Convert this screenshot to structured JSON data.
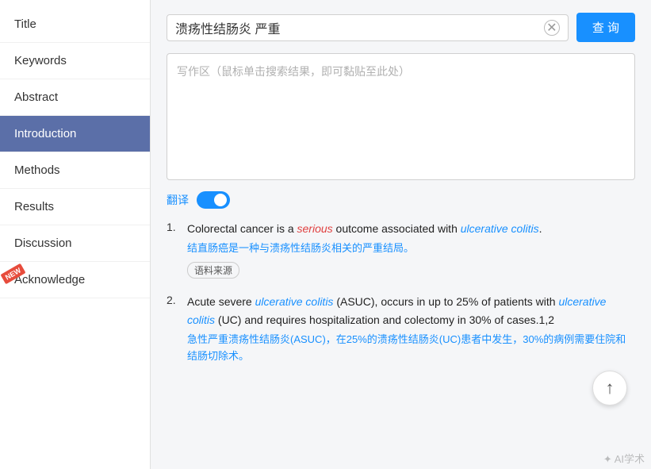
{
  "sidebar": {
    "items": [
      {
        "id": "title",
        "label": "Title",
        "active": false,
        "newBadge": false
      },
      {
        "id": "keywords",
        "label": "Keywords",
        "active": false,
        "newBadge": false
      },
      {
        "id": "abstract",
        "label": "Abstract",
        "active": false,
        "newBadge": false
      },
      {
        "id": "introduction",
        "label": "Introduction",
        "active": true,
        "newBadge": false
      },
      {
        "id": "methods",
        "label": "Methods",
        "active": false,
        "newBadge": false
      },
      {
        "id": "results",
        "label": "Results",
        "active": false,
        "newBadge": false
      },
      {
        "id": "discussion",
        "label": "Discussion",
        "active": false,
        "newBadge": false
      },
      {
        "id": "acknowledge",
        "label": "Acknowledge",
        "active": false,
        "newBadge": true
      }
    ]
  },
  "search": {
    "value": "溃疡性结肠炎 严重",
    "button_label": "查 询",
    "clear_title": "clear"
  },
  "writing_area": {
    "placeholder": "写作区（鼠标单击搜索结果，即可黏贴至此处）"
  },
  "translate": {
    "label": "翻译",
    "enabled": true
  },
  "results": [
    {
      "number": "1.",
      "en_parts": [
        {
          "text": "Colorectal cancer is a ",
          "style": "normal"
        },
        {
          "text": "serious",
          "style": "italic-red"
        },
        {
          "text": " outcome associated with ",
          "style": "normal"
        },
        {
          "text": "ulcerative colitis",
          "style": "italic-blue"
        },
        {
          "text": ".",
          "style": "normal"
        }
      ],
      "zh": "结直肠癌是一种与溃疡性结肠炎相关的严重结局。",
      "source": "语料来源"
    },
    {
      "number": "2.",
      "en_parts": [
        {
          "text": "Acute severe ",
          "style": "normal"
        },
        {
          "text": "ulcerative colitis",
          "style": "italic-blue"
        },
        {
          "text": " (ASUC), occurs in up to 25% of patients with ",
          "style": "normal"
        },
        {
          "text": "ulcerative colitis",
          "style": "italic-blue"
        },
        {
          "text": " (UC) and requires hospitalization and colectomy in 30% of cases.1,2",
          "style": "normal"
        }
      ],
      "zh": "急性严重溃疡性结肠炎(ASUC)，在25%的溃疡性结肠炎(UC)患者中发生，30%的病例需要住院和结肠切除术。",
      "source": null
    }
  ],
  "watermark": "✦ AI学术",
  "scroll_top_icon": "↑",
  "badge_new": "NEW"
}
